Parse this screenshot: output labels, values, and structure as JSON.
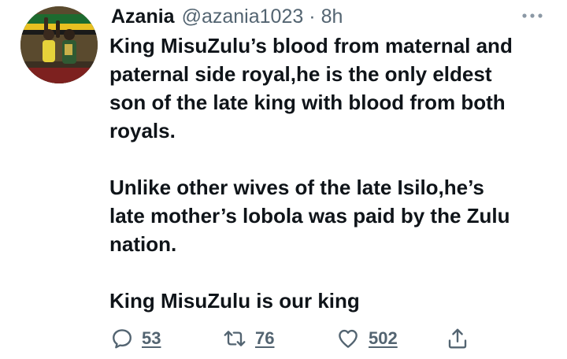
{
  "author": {
    "display_name": "Azania",
    "handle": "@azania1023",
    "separator": "·",
    "time": "8h"
  },
  "tweet": {
    "paragraphs": [
      "King MisuZulu’s blood from maternal and\npaternal side royal,he is the only eldest\nson of the late king with blood from both\nroyals.",
      "Unlike other wives of the late Isilo,he’s\nlate mother’s lobola was paid by the Zulu\nnation.",
      "King MisuZulu is our king"
    ]
  },
  "actions": {
    "replies": "53",
    "retweets": "76",
    "likes": "502"
  },
  "icons": {
    "more": "more-horizontal-icon",
    "reply": "reply-icon",
    "retweet": "retweet-icon",
    "like": "heart-icon",
    "share": "share-icon"
  },
  "colors": {
    "text": "#0f1419",
    "secondary": "#536471",
    "background": "#ffffff"
  }
}
